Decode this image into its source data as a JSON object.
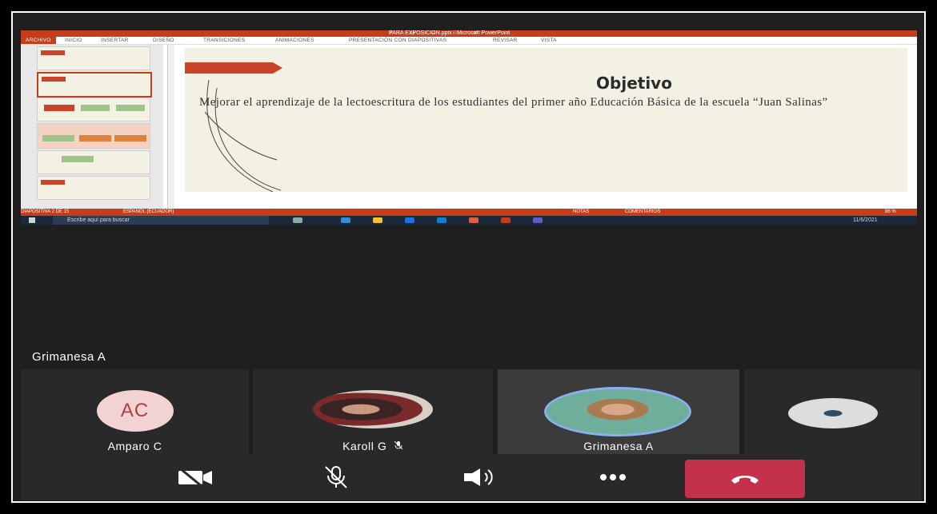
{
  "powerpoint": {
    "window_title": "PARA EXPOSICION.pptx - Microsoft PowerPoint",
    "ribbon_tabs": [
      "ARCHIVO",
      "INICIO",
      "INSERTAR",
      "DISEÑO",
      "TRANSICIONES",
      "ANIMACIONES",
      "PRESENTACIÓN CON DIAPOSITIVAS",
      "REVISAR",
      "VISTA"
    ],
    "slide": {
      "title": "Objetivo",
      "body": "Mejorar el aprendizaje de la lectoescritura de los estudiantes del primer año Educación Básica de la escuela “Juan Salinas”"
    },
    "status": {
      "slide_counter": "DIAPOSITIVA 2 DE 15",
      "language": "ESPAÑOL (ECUADOR)",
      "notes": "NOTAS",
      "comments": "COMENTARIOS",
      "zoom": "86 %"
    },
    "taskbar": {
      "search_placeholder": "Escribe aquí para buscar",
      "date": "11/6/2021"
    }
  },
  "meeting": {
    "active_speaker": "Grimanesa A",
    "participants": [
      {
        "name": "Amparo C",
        "initials": "AC"
      },
      {
        "name": "Karoll G",
        "muted": true
      },
      {
        "name": "Grimanesa A"
      },
      {
        "name": ""
      }
    ],
    "colors": {
      "hangup": "#c4314b",
      "speaker_ring": "#8ab0f0"
    }
  }
}
